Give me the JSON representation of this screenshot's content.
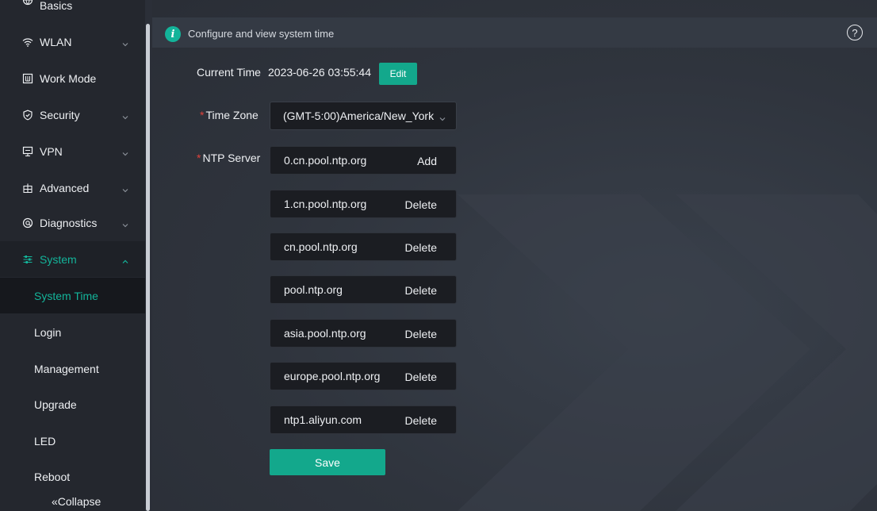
{
  "sidebar": {
    "basics_label": "Basics",
    "items": [
      {
        "label": "WLAN",
        "icon": "wifi-icon",
        "has_chevron": true
      },
      {
        "label": "Work Mode",
        "icon": "work-mode-icon",
        "has_chevron": false
      },
      {
        "label": "Security",
        "icon": "shield-icon",
        "has_chevron": true
      },
      {
        "label": "VPN",
        "icon": "vpn-icon",
        "has_chevron": true
      },
      {
        "label": "Advanced",
        "icon": "advanced-icon",
        "has_chevron": true
      },
      {
        "label": "Diagnostics",
        "icon": "diagnostics-icon",
        "has_chevron": true
      },
      {
        "label": "System",
        "icon": "sliders-icon",
        "has_chevron": true,
        "expanded": true
      }
    ],
    "sub_items": [
      {
        "label": "System Time",
        "active": true
      },
      {
        "label": "Login"
      },
      {
        "label": "Management"
      },
      {
        "label": "Upgrade"
      },
      {
        "label": "LED"
      },
      {
        "label": "Reboot"
      }
    ],
    "collapse_label": "«Collapse"
  },
  "info": {
    "text": "Configure and view system time",
    "info_icon": "i",
    "help_icon": "?"
  },
  "form": {
    "current_time_label": "Current Time",
    "current_time_value": "2023-06-26 03:55:44",
    "edit_label": "Edit",
    "time_zone_label": "Time Zone",
    "time_zone_value": "(GMT-5:00)America/New_York",
    "ntp_label": "NTP Server",
    "required_mark": "*",
    "ntp_servers": [
      {
        "address": "0.cn.pool.ntp.org",
        "action": "Add"
      },
      {
        "address": "1.cn.pool.ntp.org",
        "action": "Delete"
      },
      {
        "address": "cn.pool.ntp.org",
        "action": "Delete"
      },
      {
        "address": "pool.ntp.org",
        "action": "Delete"
      },
      {
        "address": "asia.pool.ntp.org",
        "action": "Delete"
      },
      {
        "address": "europe.pool.ntp.org",
        "action": "Delete"
      },
      {
        "address": "ntp1.aliyun.com",
        "action": "Delete"
      }
    ],
    "save_label": "Save"
  },
  "colors": {
    "accent": "#13a88c",
    "active_text": "#13b49a",
    "required": "#e0423b"
  }
}
